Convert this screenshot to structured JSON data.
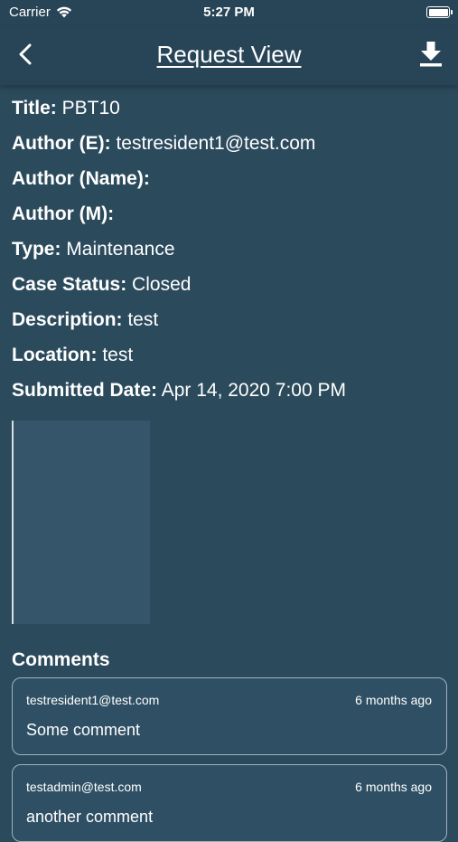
{
  "status_bar": {
    "carrier": "Carrier",
    "time": "5:27 PM"
  },
  "header": {
    "title": "Request View",
    "back_icon": "chevron-left-icon",
    "download_icon": "download-icon"
  },
  "details": [
    {
      "label": "Title:",
      "value": " PBT10"
    },
    {
      "label": "Author (E):",
      "value": " testresident1@test.com"
    },
    {
      "label": "Author (Name):",
      "value": ""
    },
    {
      "label": "Author (M):",
      "value": ""
    },
    {
      "label": "Type:",
      "value": " Maintenance"
    },
    {
      "label": "Case Status:",
      "value": " Closed"
    },
    {
      "label": "Description:",
      "value": " test"
    },
    {
      "label": "Location:",
      "value": " test"
    },
    {
      "label": "Submitted Date:",
      "value": " Apr 14, 2020 7:00 PM"
    }
  ],
  "comments": {
    "heading": "Comments",
    "items": [
      {
        "author": "testresident1@test.com",
        "time": "6 months ago",
        "text": "Some comment"
      },
      {
        "author": "testadmin@test.com",
        "time": "6 months ago",
        "text": "another comment"
      }
    ]
  },
  "colors": {
    "background": "#2b4a5c",
    "navbar": "#284557",
    "card": "#2f5064",
    "text": "#ffffff"
  }
}
